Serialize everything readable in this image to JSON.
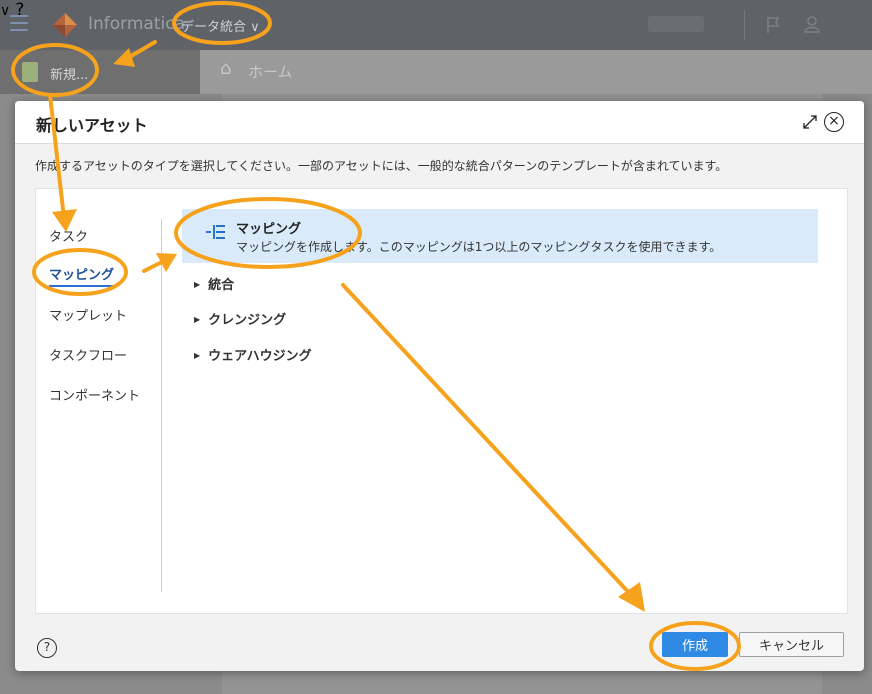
{
  "app": {
    "brand": "Informatica",
    "service": "データ統合 ∨",
    "new_button": "新規...",
    "home_tab": "ホーム"
  },
  "dialog": {
    "title": "新しいアセット",
    "description": "作成するアセットのタイプを選択してください。一部のアセットには、一般的な統合パターンのテンプレートが含まれています。",
    "nav": [
      "タスク",
      "マッピング",
      "マップレット",
      "タスクフロー",
      "コンポーネント"
    ],
    "active_nav": "マッピング",
    "selected_asset": {
      "title": "マッピング",
      "description": "マッピングを作成します。このマッピングは1つ以上のマッピングタスクを使用できます。"
    },
    "categories": [
      "統合",
      "クレンジング",
      "ウェアハウジング"
    ],
    "create_button": "作成",
    "cancel_button": "キャンセル",
    "help_glyph": "?",
    "close_glyph": "×"
  },
  "colors": {
    "accent": "#2f8ae6",
    "highlight": "#d9ebfb",
    "annotation": "#f6a21c"
  },
  "icons": [
    "menu-icon",
    "informatica-logo",
    "chevron-down-icon",
    "flag-icon",
    "user-icon",
    "help-icon",
    "home-icon",
    "expand-icon",
    "close-icon",
    "mapping-icon"
  ]
}
